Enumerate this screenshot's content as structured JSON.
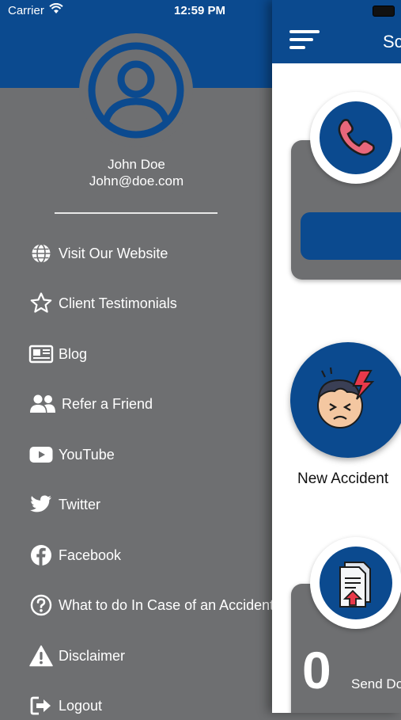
{
  "status_bar": {
    "carrier": "Carrier",
    "time": "12:59 PM"
  },
  "drawer": {
    "user": {
      "name": "John Doe",
      "email": "John@doe.com"
    },
    "menu": [
      {
        "label": "Visit Our Website",
        "icon": "globe-icon"
      },
      {
        "label": "Client Testimonials",
        "icon": "star-icon"
      },
      {
        "label": "Blog",
        "icon": "newspaper-icon"
      },
      {
        "label": "Refer a Friend",
        "icon": "users-icon"
      },
      {
        "label": "YouTube",
        "icon": "youtube-icon"
      },
      {
        "label": "Twitter",
        "icon": "twitter-icon"
      },
      {
        "label": "Facebook",
        "icon": "facebook-icon"
      },
      {
        "label": "What to do In Case of an Accident",
        "icon": "question-circle-icon"
      },
      {
        "label": "Disclaimer",
        "icon": "warning-icon"
      },
      {
        "label": "Logout",
        "icon": "logout-icon"
      }
    ]
  },
  "main": {
    "header_title": "Sc",
    "new_accident_label": "New Accident",
    "documents_count": "0",
    "send_label": "Send Do"
  },
  "colors": {
    "brand_blue": "#0b4a8f",
    "drawer_gray": "#6e6f71",
    "accent_red": "#e0445a"
  }
}
